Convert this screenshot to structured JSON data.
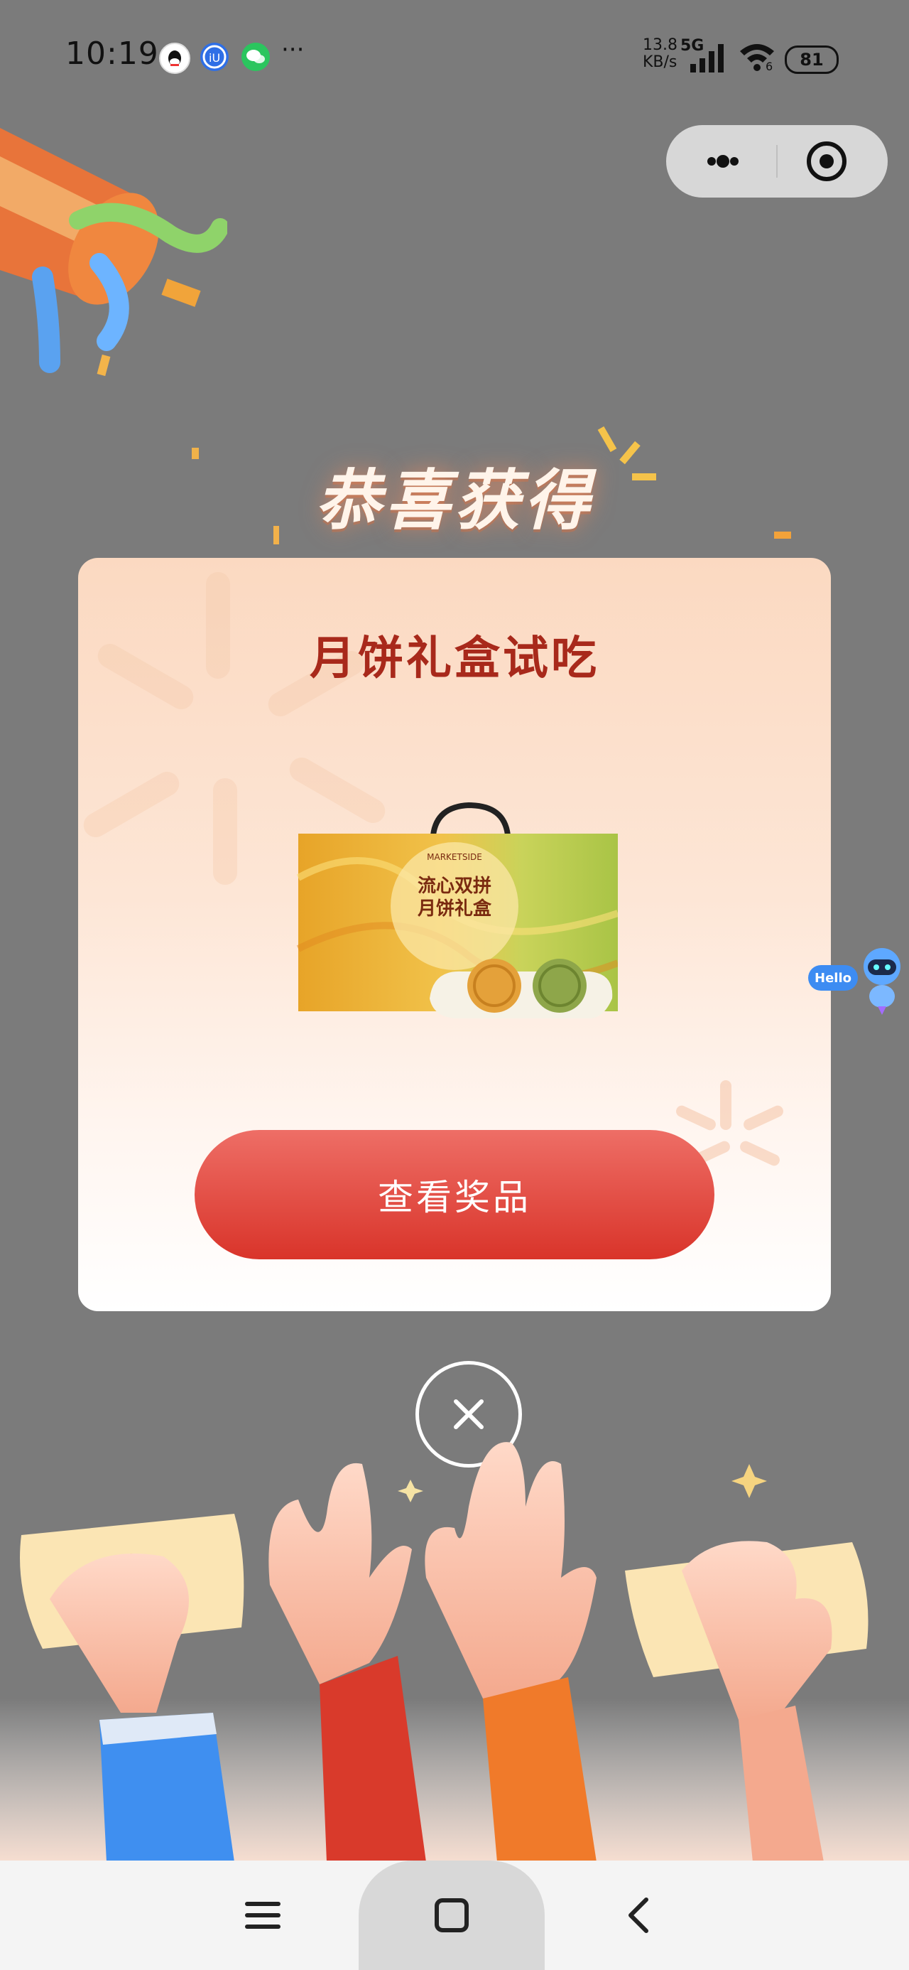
{
  "status_bar": {
    "time": "10:19",
    "more_dots": "···",
    "net_speed_value": "13.8",
    "net_speed_unit": "KB/s",
    "network": "5G",
    "wifi_sub": "6",
    "battery": "81"
  },
  "popup": {
    "headline": "恭喜获得",
    "prize_title": "月饼礼盒试吃",
    "cta_label": "查看奖品",
    "product_brand": "MARKETSIDE",
    "product_name_line1": "流心双拼",
    "product_name_line2": "月饼礼盒"
  },
  "floating_bot": {
    "bubble_text": "Hello"
  },
  "colors": {
    "overlay": "#7b7b7b",
    "title_red": "#a8291b",
    "cta_top": "#ee6e66",
    "cta_bottom": "#d9342a"
  }
}
